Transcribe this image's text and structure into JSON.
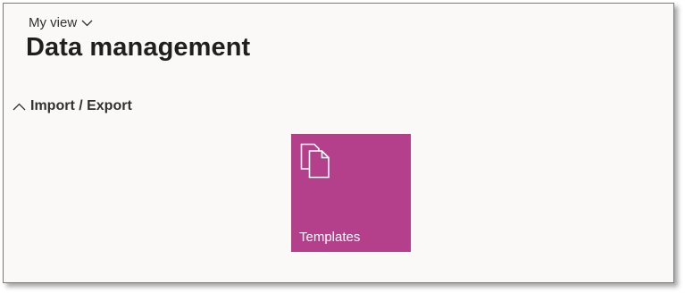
{
  "header": {
    "view_selector_label": "My view",
    "page_title": "Data management"
  },
  "section": {
    "title": "Import / Export",
    "tiles": [
      {
        "label": "Templates",
        "icon": "copy-documents-icon",
        "color": "#b4408c"
      }
    ]
  }
}
